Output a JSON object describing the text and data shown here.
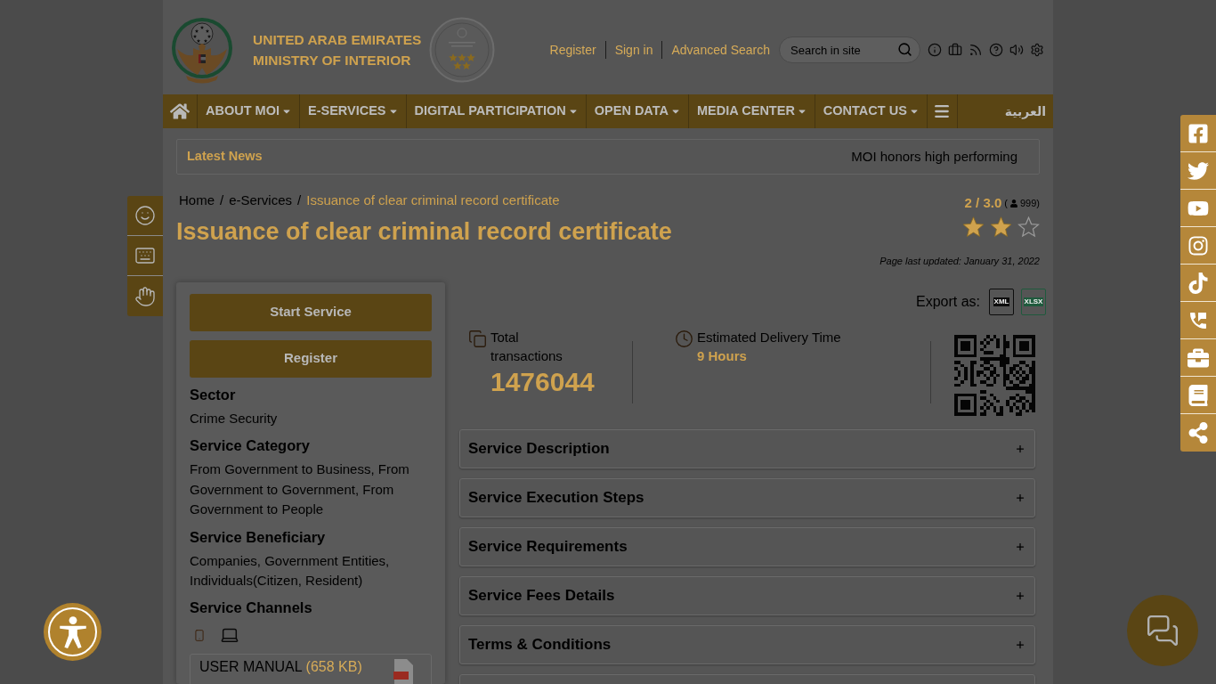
{
  "header": {
    "logo_lines": [
      "UNITED ARAB EMIRATES",
      "MINISTRY OF INTERIOR"
    ],
    "links": [
      "Register",
      "Sign in",
      "Advanced Search"
    ],
    "search": {
      "placeholder": "Search in site"
    }
  },
  "nav": {
    "items": [
      {
        "label": "ABOUT MOI",
        "dropdown": true
      },
      {
        "label": "E-SERVICES",
        "dropdown": true
      },
      {
        "label": "DIGITAL PARTICIPATION",
        "dropdown": true
      },
      {
        "label": "OPEN DATA",
        "dropdown": true
      },
      {
        "label": "MEDIA CENTER",
        "dropdown": true
      },
      {
        "label": "CONTACT US",
        "dropdown": true
      }
    ],
    "language": "العربية"
  },
  "ticker": {
    "label": "Latest News",
    "headline": "MOI honors high performing"
  },
  "breadcrumb": [
    {
      "label": "Home",
      "separator": "/",
      "current": false
    },
    {
      "label": "e-Services",
      "separator": "/",
      "current": false
    },
    {
      "label": "Issuance of clear criminal record certificate",
      "current": true
    }
  ],
  "title": "Issuance of clear criminal record certificate",
  "rating": {
    "score": "2 / 3.0",
    "votes_open": "(",
    "votes": "999)",
    "stars": 2
  },
  "last_updated": "Page last updated: January 31, 2022",
  "sidebar": {
    "buttons": [
      "Start Service",
      "Register"
    ],
    "sections": [
      {
        "heading": "Sector",
        "text": "Crime Security"
      },
      {
        "heading": "Service Category",
        "text": "From Government to Business, From Government to Government, From Government to People"
      },
      {
        "heading": "Service Beneficiary",
        "text": "Companies, Government Entities, Individuals(Citizen, Resident)"
      }
    ],
    "channels_heading": "Service Channels",
    "manual": {
      "label": "USER MANUAL",
      "size": "(658 KB)"
    }
  },
  "export": {
    "label": "Export as:",
    "formats": [
      {
        "label": "XML",
        "color": "#0d0d0d"
      },
      {
        "label": "XLSX",
        "color": "#1f5a3d"
      }
    ]
  },
  "stats": [
    {
      "kind": "count",
      "label": "Total transactions",
      "value": "1476044"
    },
    {
      "kind": "duration",
      "label": "Estimated Delivery Time",
      "value": "9 Hours"
    }
  ],
  "accordion": [
    {
      "title": "Service Description",
      "expanded": false
    },
    {
      "title": "Service Execution Steps",
      "expanded": false
    },
    {
      "title": "Service Requirements",
      "expanded": false
    },
    {
      "title": "Service Fees Details",
      "expanded": false
    },
    {
      "title": "Terms & Conditions",
      "expanded": false
    },
    {
      "expanded": false
    }
  ]
}
